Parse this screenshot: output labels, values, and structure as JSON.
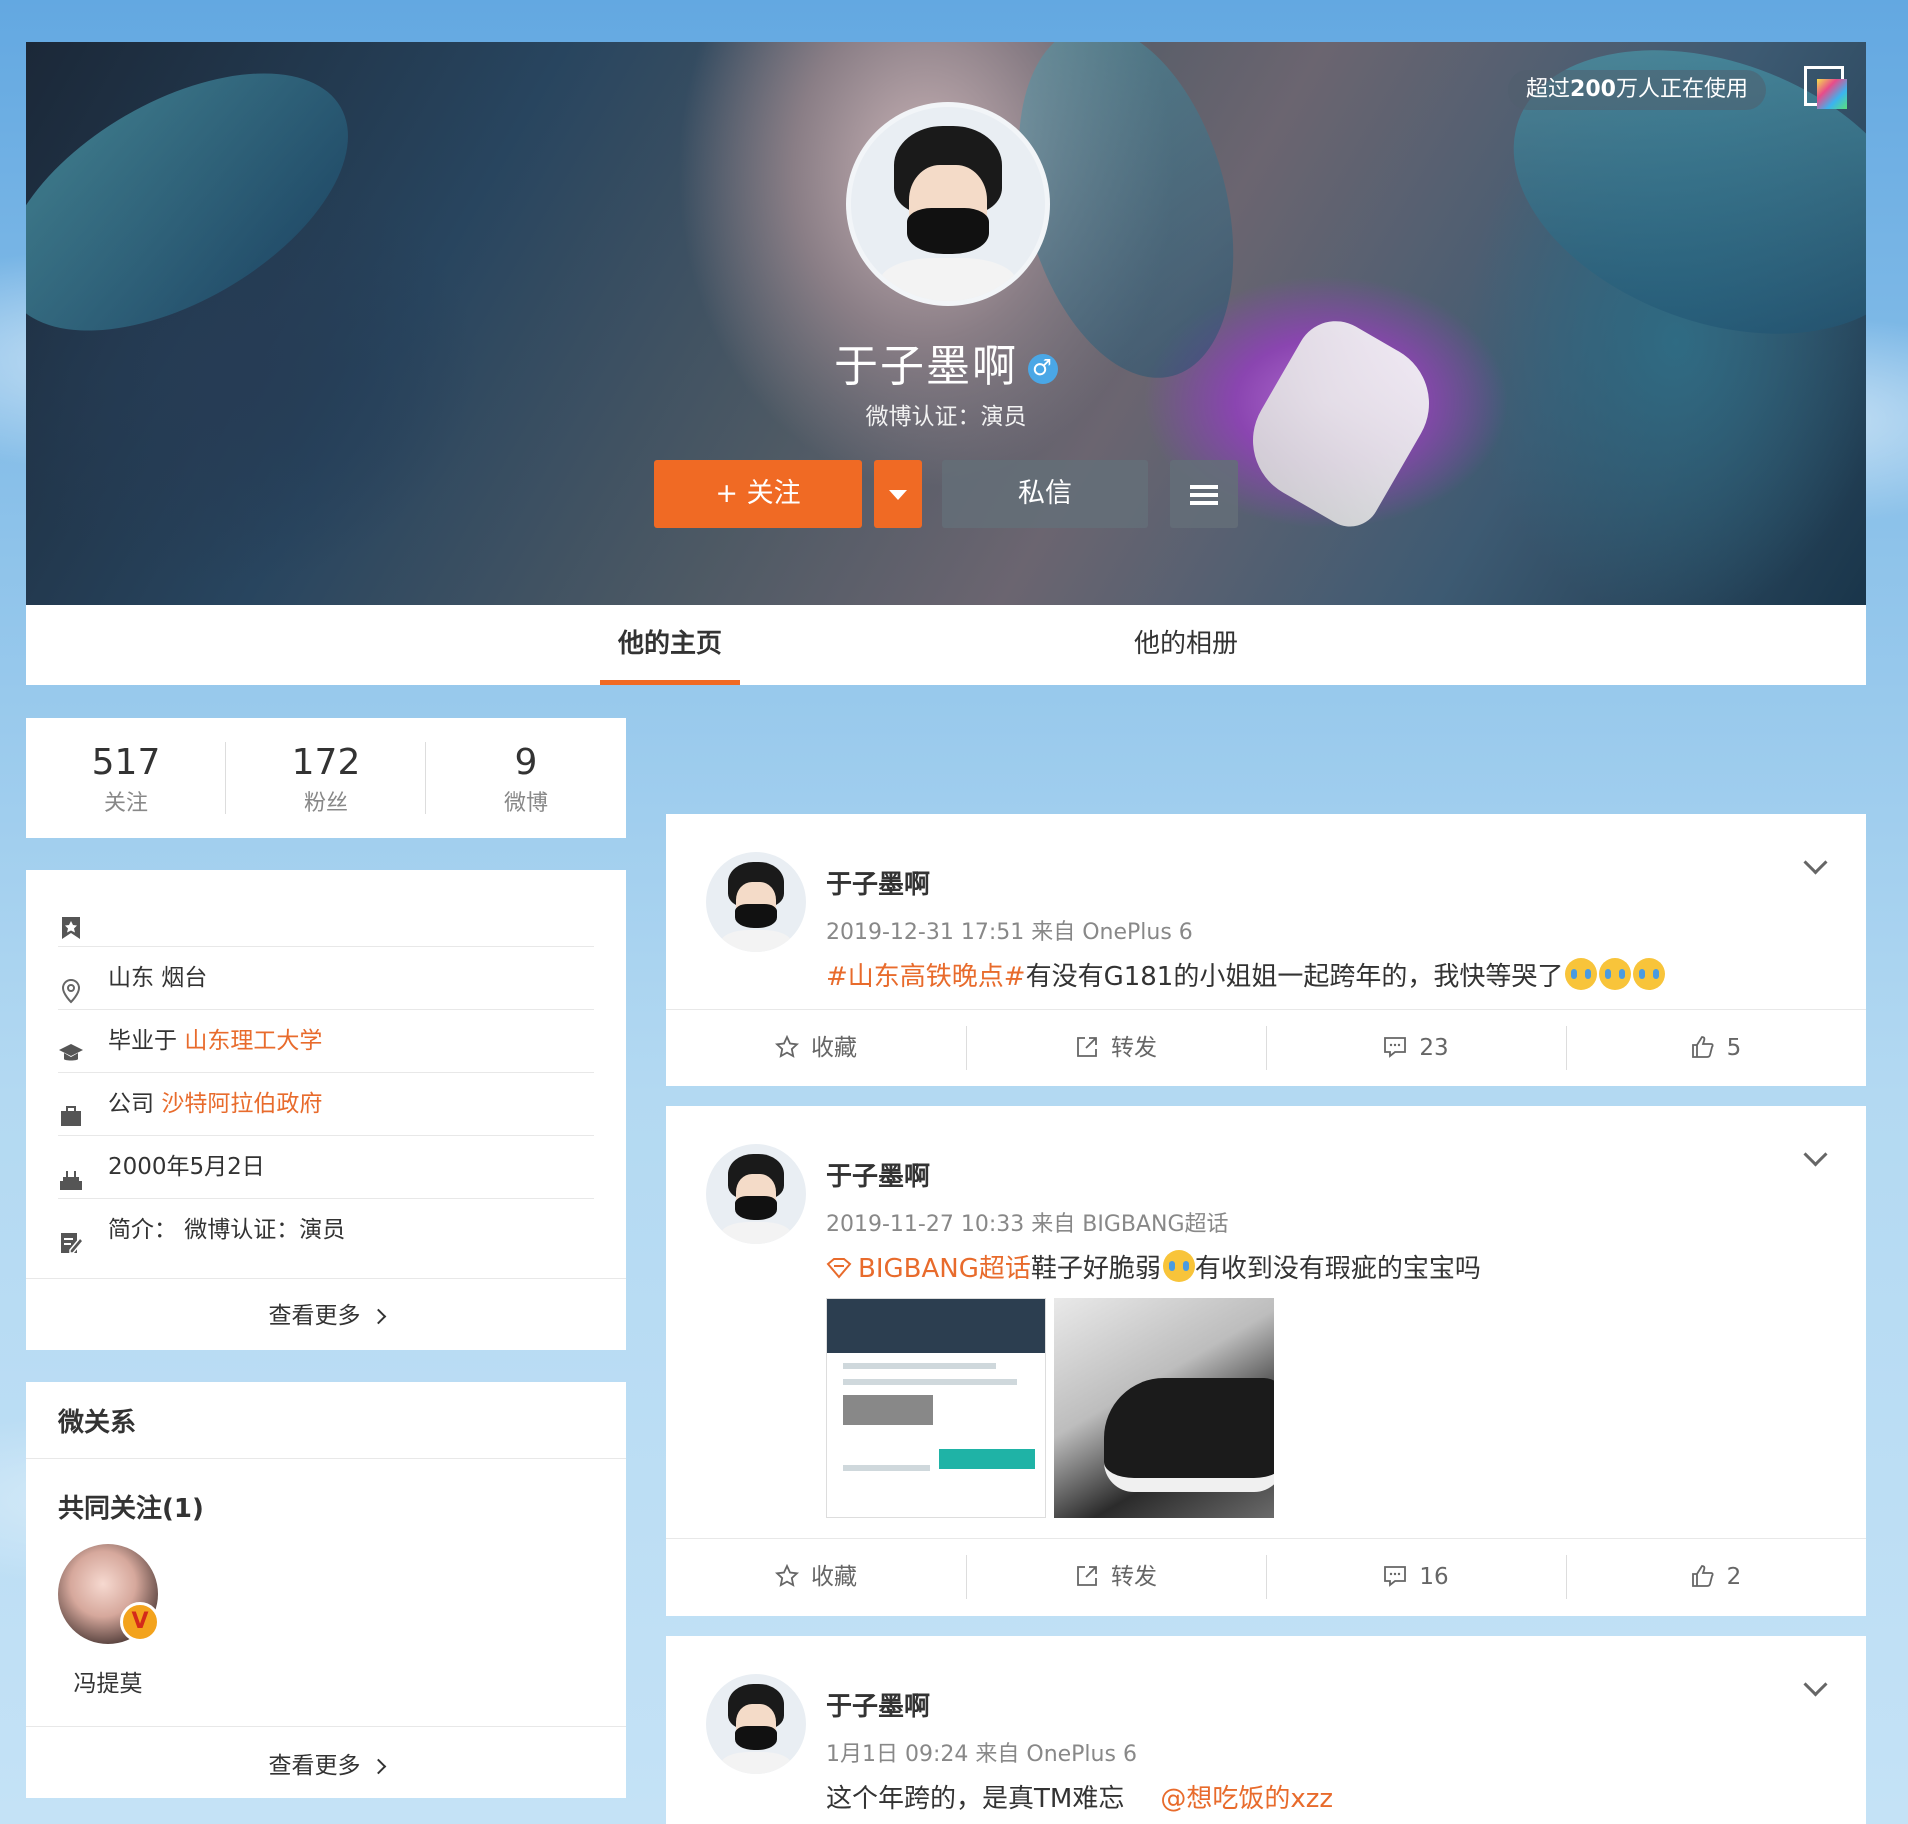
{
  "cover": {
    "usage_prefix": "超过",
    "usage_bold": "200",
    "usage_suffix": "万人正在使用",
    "name": "于子墨啊",
    "gender_symbol": "♂",
    "verify": "微博认证：演员",
    "follow_label": "+ 关注",
    "message_label": "私信"
  },
  "tabs": [
    {
      "label": "他的主页",
      "active": true
    },
    {
      "label": "他的相册",
      "active": false
    }
  ],
  "stats": [
    {
      "value": "517",
      "label": "关注"
    },
    {
      "value": "172",
      "label": "粉丝"
    },
    {
      "value": "9",
      "label": "微博"
    }
  ],
  "info": {
    "location": "山东 烟台",
    "edu_prefix": "毕业于",
    "edu_link": "山东理工大学",
    "company_prefix": "公司",
    "company_link": "沙特阿拉伯政府",
    "birthday": "2000年5月2日",
    "bio": "简介：  微博认证：演员",
    "more": "查看更多"
  },
  "relations": {
    "title": "微关系",
    "common_title": "共同关注(1)",
    "friend_name": "冯提莫",
    "friend_badge": "V",
    "more": "查看更多"
  },
  "posts": [
    {
      "name": "于子墨啊",
      "meta": "2019-12-31 17:51 来自 OnePlus 6",
      "tag": "#山东高铁晚点#",
      "text": "有没有G181的小姐姐一起跨年的，我快等哭了",
      "fav": "收藏",
      "repost": "转发",
      "comments": "23",
      "likes": "5"
    },
    {
      "name": "于子墨啊",
      "meta": "2019-11-27 10:33 来自 BIGBANG超话",
      "tag": "BIGBANG超话",
      "text_a": "鞋子好脆弱",
      "text_b": "有收到没有瑕疵的宝宝吗",
      "fav": "收藏",
      "repost": "转发",
      "comments": "16",
      "likes": "2"
    },
    {
      "name": "于子墨啊",
      "meta": "1月1日 09:24 来自 OnePlus 6",
      "text": "这个年跨的，是真TM难忘",
      "mention": "@想吃饭的xzz"
    }
  ],
  "colors": {
    "accent": "#f06a24",
    "link": "#e86b2c"
  }
}
